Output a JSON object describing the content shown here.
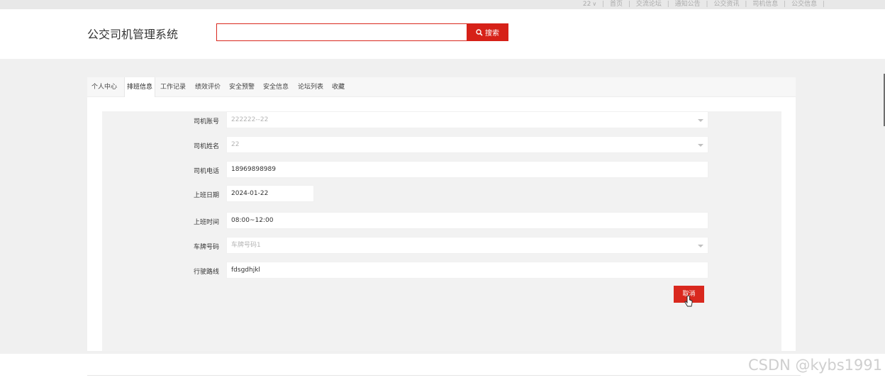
{
  "topbar": {
    "user": "22",
    "links": [
      "首页",
      "交流论坛",
      "通知公告",
      "公交资讯",
      "司机信息",
      "公交信息"
    ]
  },
  "header": {
    "title": "公交司机管理系统",
    "search_value": "",
    "search_button": "搜索"
  },
  "tabs": [
    {
      "label": "个人中心",
      "active": false
    },
    {
      "label": "排班信息",
      "active": true
    },
    {
      "label": "工作记录",
      "active": false
    },
    {
      "label": "绩效评价",
      "active": false
    },
    {
      "label": "安全预警",
      "active": false
    },
    {
      "label": "安全信息",
      "active": false
    },
    {
      "label": "论坛列表",
      "active": false
    },
    {
      "label": "收藏",
      "active": false
    }
  ],
  "form": {
    "driver_account": {
      "label": "司机账号",
      "value": "222222--22"
    },
    "driver_name": {
      "label": "司机姓名",
      "value": "22"
    },
    "driver_phone": {
      "label": "司机电话",
      "value": "18969898989"
    },
    "work_date": {
      "label": "上班日期",
      "value": "2024-01-22"
    },
    "work_time": {
      "label": "上班时间",
      "value": "08:00~12:00"
    },
    "plate_number": {
      "label": "车牌号码",
      "value": "车牌号码1"
    },
    "route": {
      "label": "行驶路线",
      "value": "fdsgdhjkl"
    }
  },
  "cancel_button": "取消",
  "watermark": "CSDN @kybs1991",
  "colors": {
    "accent": "#d62118",
    "page_bg": "#f0f0f0"
  }
}
